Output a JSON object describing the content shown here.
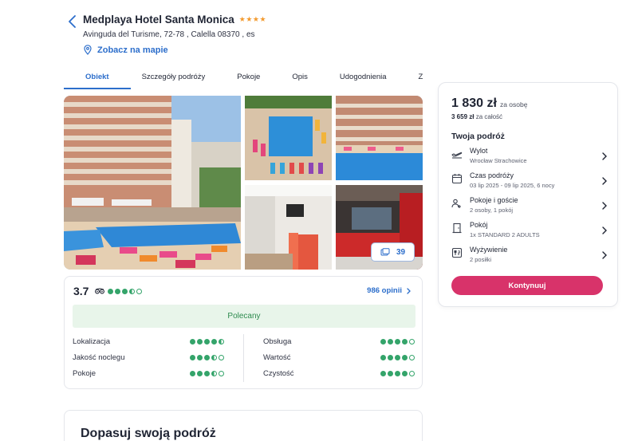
{
  "hotel": {
    "name": "Medplaya Hotel Santa Monica",
    "stars": "★★★★",
    "address": "Avinguda del Turisme, 72-78 , Calella 08370 , es",
    "map_link": "Zobacz na mapie"
  },
  "tabs": [
    {
      "label": "Obiekt"
    },
    {
      "label": "Szczegóły podróży"
    },
    {
      "label": "Pokoje"
    },
    {
      "label": "Opis"
    },
    {
      "label": "Udogodnienia"
    },
    {
      "label": "Za"
    }
  ],
  "gallery": {
    "photo_count": "39"
  },
  "rating": {
    "score": "3.7",
    "reviews": "986 opinii",
    "recommended": "Polecany",
    "categories": [
      {
        "label": "Lokalizacja",
        "dots": 4.5
      },
      {
        "label": "Jakość noclegu",
        "dots": 3.5
      },
      {
        "label": "Pokoje",
        "dots": 3.5
      },
      {
        "label": "Obsługa",
        "dots": 4
      },
      {
        "label": "Wartość",
        "dots": 4
      },
      {
        "label": "Czystość",
        "dots": 4
      }
    ],
    "overall_dots": 3.5
  },
  "next_section": {
    "title": "Dopasuj swoją podróż"
  },
  "summary": {
    "price": "1 830 zł",
    "price_per": "za osobę",
    "total_amount": "3 659 zł",
    "total_label": "za całość",
    "trip_title": "Twoja podróż",
    "items": [
      {
        "title": "Wylot",
        "value": "Wrocław Strachowice"
      },
      {
        "title": "Czas podróży",
        "value": "03 lip 2025 - 09 lip 2025, 6 nocy"
      },
      {
        "title": "Pokoje i goście",
        "value": "2 osoby, 1 pokój"
      },
      {
        "title": "Pokój",
        "value": "1x STANDARD 2 ADULTS"
      },
      {
        "title": "Wyżywienie",
        "value": "2 posiłki"
      }
    ],
    "continue_label": "Kontynuuj"
  },
  "colors": {
    "accent": "#2c6ecb",
    "cta": "#d8336a",
    "rating_green": "#34a46a"
  }
}
